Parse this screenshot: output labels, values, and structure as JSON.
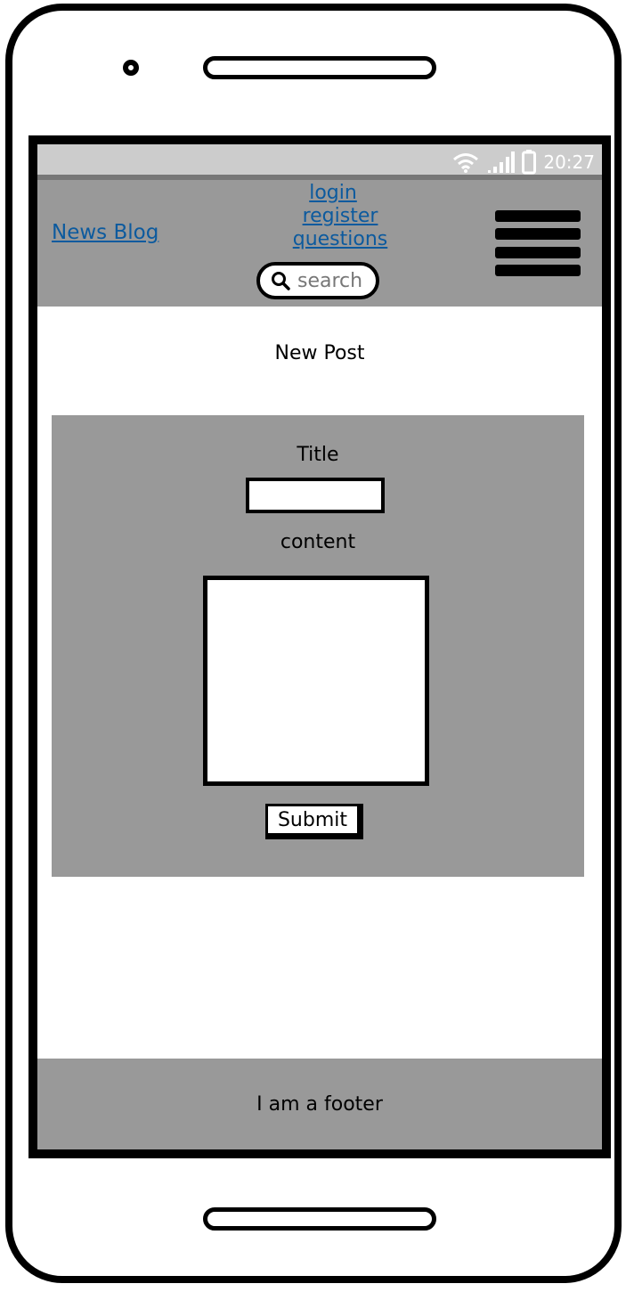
{
  "status_bar": {
    "time": "20:27",
    "icons": [
      "wifi-icon",
      "signal-icon",
      "battery-icon"
    ]
  },
  "header": {
    "brand": "News Blog",
    "nav": {
      "login": "login",
      "register": "register",
      "questions": "questions"
    },
    "search_placeholder": "search",
    "menu_icon": "hamburger-menu-icon"
  },
  "page": {
    "heading": "New Post"
  },
  "form": {
    "title_label": "Title",
    "content_label": "content",
    "submit_label": "Submit"
  },
  "footer": {
    "text": "I am a footer"
  },
  "colors": {
    "link": "#0c5a9e",
    "panel": "#999999",
    "status_bar": "#cccccc"
  }
}
